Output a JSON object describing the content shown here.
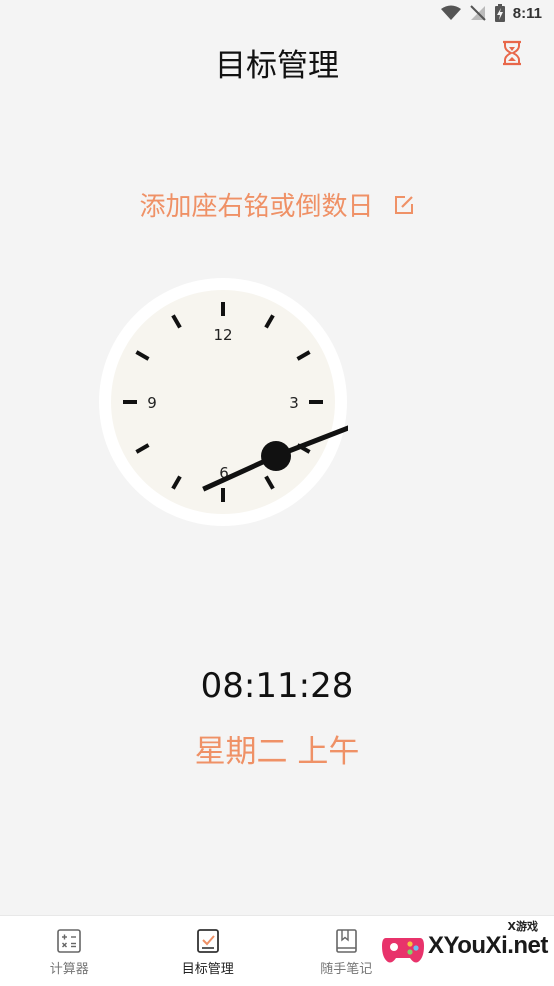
{
  "status_bar": {
    "time": "8:11",
    "icons": [
      "wifi-icon",
      "no-signal-icon",
      "battery-charging-icon"
    ]
  },
  "header": {
    "title": "目标管理",
    "action_icon": "hourglass-icon"
  },
  "motto": {
    "text": "添加座右铭或倒数日",
    "icon": "edit-icon"
  },
  "clock": {
    "numerals": [
      "12",
      "3",
      "6",
      "9"
    ],
    "hour": 8,
    "minute": 11,
    "second": 28
  },
  "time_display": "08:11:28",
  "day_display": "星期二 上午",
  "bottom_nav": {
    "items": [
      {
        "label": "计算器",
        "icon": "calculator-icon",
        "active": false
      },
      {
        "label": "目标管理",
        "icon": "goal-checklist-icon",
        "active": true
      },
      {
        "label": "随手笔记",
        "icon": "notebook-icon",
        "active": false
      }
    ]
  },
  "watermark": {
    "small_text": "X游戏",
    "brand": "XYouXi.net"
  },
  "colors": {
    "accent": "#ef9166",
    "hourglass": "#e8674a",
    "clock_face": "#f7f5ef",
    "background": "#f4f4f4"
  }
}
